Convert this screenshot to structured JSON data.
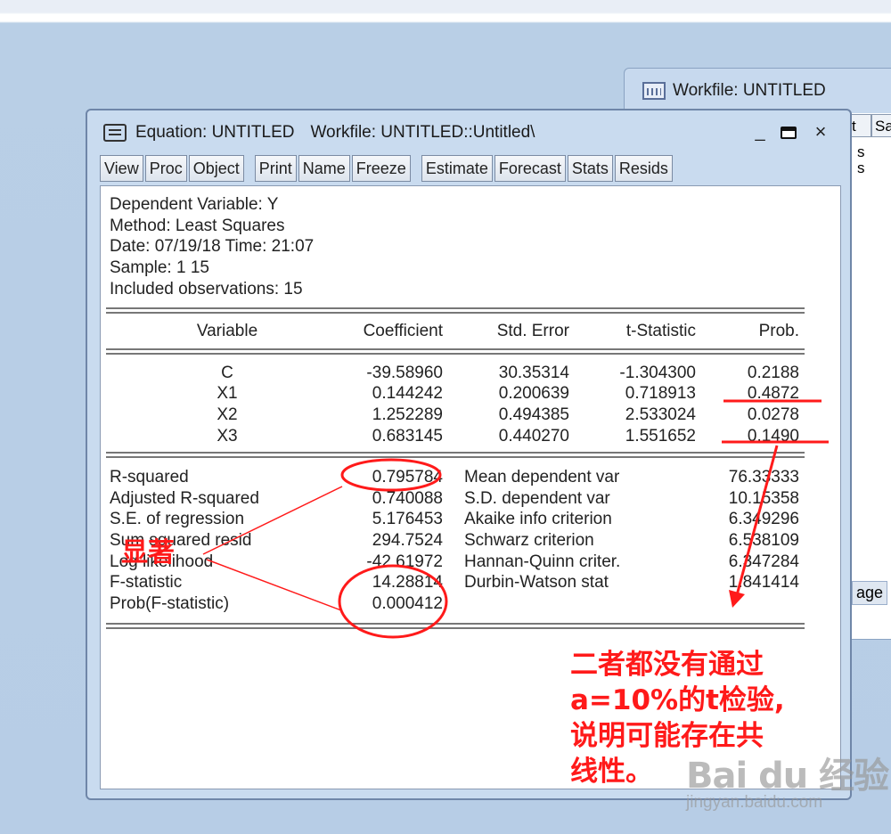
{
  "background_window": {
    "title": "Workfile: UNTITLED",
    "tab_labels": [
      "t",
      "Sa"
    ],
    "side_text": [
      "s",
      "s"
    ],
    "stage_label": "age"
  },
  "equation_window": {
    "title": "Equation: UNTITLED",
    "subtitle": "Workfile: UNTITLED::Untitled\\",
    "minimize": "_",
    "close": "×",
    "toolbar": [
      "View",
      "Proc",
      "Object",
      "Print",
      "Name",
      "Freeze",
      "Estimate",
      "Forecast",
      "Stats",
      "Resids"
    ]
  },
  "header": {
    "dependent": "Dependent Variable: Y",
    "method": "Method: Least Squares",
    "date_time": "Date: 07/19/18   Time: 21:07",
    "sample": "Sample: 1 15",
    "observations": "Included observations: 15"
  },
  "columns": [
    "Variable",
    "Coefficient",
    "Std. Error",
    "t-Statistic",
    "Prob."
  ],
  "coefficients": [
    {
      "variable": "C",
      "coefficient": "-39.58960",
      "std_error": "30.35314",
      "t_stat": "-1.304300",
      "prob": "0.2188"
    },
    {
      "variable": "X1",
      "coefficient": "0.144242",
      "std_error": "0.200639",
      "t_stat": "0.718913",
      "prob": "0.4872"
    },
    {
      "variable": "X2",
      "coefficient": "1.252289",
      "std_error": "0.494385",
      "t_stat": "2.533024",
      "prob": "0.0278"
    },
    {
      "variable": "X3",
      "coefficient": "0.683145",
      "std_error": "0.440270",
      "t_stat": "1.551652",
      "prob": "0.1490"
    }
  ],
  "stats": [
    {
      "label": "R-squared",
      "value": "0.795784",
      "label2": "Mean dependent var",
      "value2": "76.33333"
    },
    {
      "label": "Adjusted R-squared",
      "value": "0.740088",
      "label2": "S.D. dependent var",
      "value2": "10.15358"
    },
    {
      "label": "S.E. of regression",
      "value": "5.176453",
      "label2": "Akaike info criterion",
      "value2": "6.349296"
    },
    {
      "label": "Sum squared resid",
      "value": "294.7524",
      "label2": "Schwarz criterion",
      "value2": "6.538109"
    },
    {
      "label": "Log likelihood",
      "value": "-42.61972",
      "label2": "Hannan-Quinn criter.",
      "value2": "6.347284"
    },
    {
      "label": "F-statistic",
      "value": "14.28814",
      "label2": "Durbin-Watson stat",
      "value2": "1.841414"
    },
    {
      "label": "Prob(F-statistic)",
      "value": "0.000412",
      "label2": "",
      "value2": ""
    }
  ],
  "annotations": {
    "significant_label": "显著",
    "note_lines": [
      "二者都没有通过",
      "a=10%的t检验,",
      "说明可能存在共",
      "线性。"
    ],
    "annotation_color": "#ff1a1a"
  },
  "watermark": {
    "logo": "Bai du 经验",
    "url": "jingyan.baidu.com"
  },
  "colors": {
    "desktop": "#b7cde6",
    "window_frame": "#c9dbef",
    "annotation_red": "#ff1a1a"
  }
}
